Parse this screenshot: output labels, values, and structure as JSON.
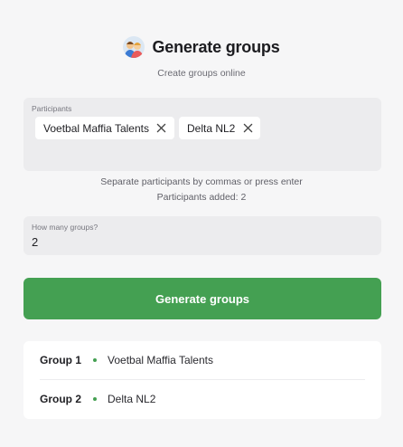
{
  "header": {
    "logo_icon": "people-group-emoji-icon",
    "title": "Generate groups",
    "subtitle": "Create groups online"
  },
  "participants": {
    "label": "Participants",
    "chips": [
      {
        "text": "Voetbal Maffia Talents",
        "remove_icon": "close-icon"
      },
      {
        "text": "Delta NL2",
        "remove_icon": "close-icon"
      }
    ],
    "hint": "Separate participants by commas or press enter",
    "count_text": "Participants added: 2"
  },
  "groups": {
    "label": "How many groups?",
    "value": "2"
  },
  "generate_button": {
    "label": "Generate groups"
  },
  "results": [
    {
      "group": "Group 1",
      "member": "Voetbal Maffia Talents"
    },
    {
      "group": "Group 2",
      "member": "Delta NL2"
    }
  ],
  "colors": {
    "accent": "#44a052",
    "background": "#f6f6f7",
    "field": "#ececee"
  }
}
